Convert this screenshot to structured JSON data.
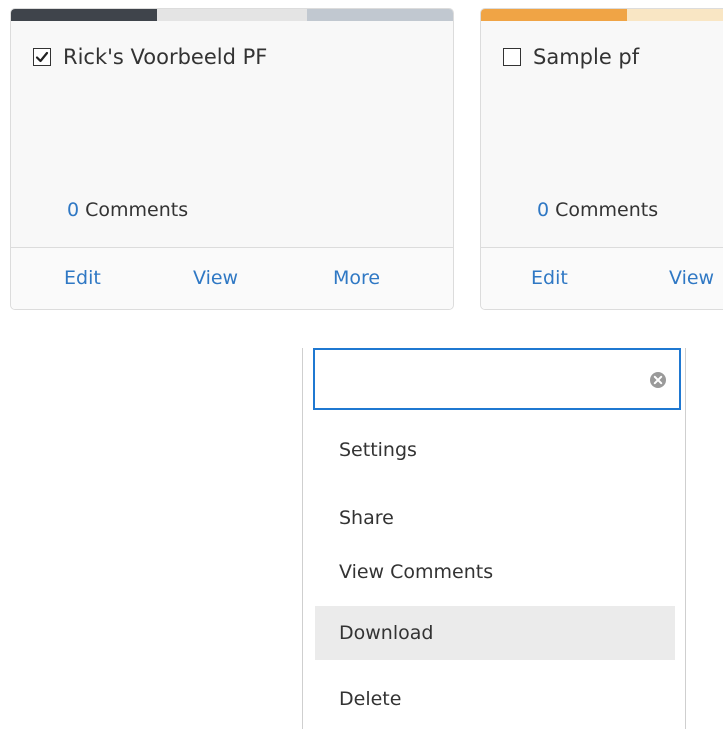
{
  "colors": {
    "card1_bar": [
      "#3f444b",
      "#e4e4e4",
      "#c1c8d0"
    ],
    "card2_bar": [
      "#f0a445",
      "#f9e6c4"
    ],
    "link": "#2f78c4",
    "search_border": "#1f78d1",
    "menu_active": "#ebebeb"
  },
  "cards": [
    {
      "title": "Rick's Voorbeeld PF",
      "checked": true,
      "comment_count": "0",
      "comment_label": " Comments",
      "actions": {
        "edit": "Edit",
        "view": "View",
        "more": "More"
      }
    },
    {
      "title": "Sample pf",
      "checked": false,
      "comment_count": "0",
      "comment_label": " Comments",
      "actions": {
        "edit": "Edit",
        "view": "View"
      }
    }
  ],
  "menu": {
    "search": {
      "value": "",
      "placeholder": ""
    },
    "items": [
      {
        "label": "Settings"
      },
      {
        "label": "Share"
      },
      {
        "label": "View Comments"
      },
      {
        "label": "Download",
        "active": true
      },
      {
        "label": "Delete"
      }
    ]
  }
}
